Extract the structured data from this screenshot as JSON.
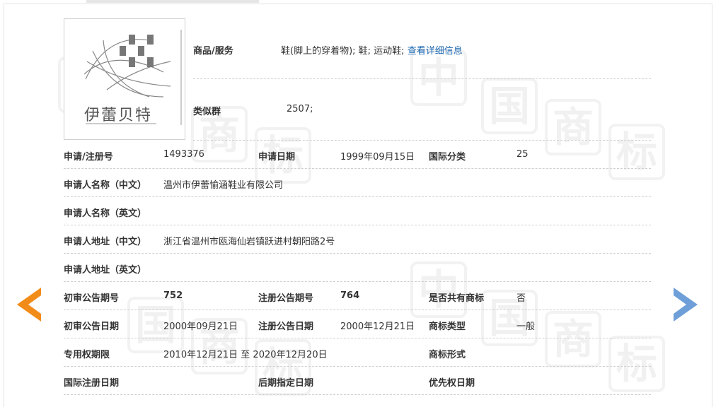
{
  "goods": {
    "label": "商品/服务",
    "value": "鞋(脚上的穿着物); 鞋; 运动鞋;",
    "link": "查看详细信息"
  },
  "similar": {
    "label": "类似群",
    "value": "2507;"
  },
  "logo": {
    "text": "伊蕾贝特"
  },
  "watermark": {
    "chars": [
      "中",
      "国",
      "商",
      "标"
    ]
  },
  "rows": {
    "reg_no": {
      "label": "申请/注册号",
      "value": "1493376"
    },
    "apply_date": {
      "label": "申请日期",
      "value": "1999年09月15日"
    },
    "intl_class": {
      "label": "国际分类",
      "value": "25"
    },
    "applicant_cn": {
      "label": "申请人名称（中文）",
      "value": "温州市伊蕾愉涵鞋业有限公司"
    },
    "applicant_en": {
      "label": "申请人名称（英文）",
      "value": ""
    },
    "address_cn": {
      "label": "申请人地址（中文）",
      "value": "浙江省温州市瓯海仙岩镇跃进村朝阳路2号"
    },
    "address_en": {
      "label": "申请人地址（英文）",
      "value": ""
    },
    "prelim_no": {
      "label": "初审公告期号",
      "value": "752"
    },
    "reg_notice_no": {
      "label": "注册公告期号",
      "value": "764"
    },
    "shared": {
      "label": "是否共有商标",
      "value": "否"
    },
    "prelim_date": {
      "label": "初审公告日期",
      "value": "2000年09月21日"
    },
    "reg_notice_date": {
      "label": "注册公告日期",
      "value": "2000年12月21日"
    },
    "mark_type": {
      "label": "商标类型",
      "value": "一般"
    },
    "term": {
      "label": "专用权期限",
      "value": "2010年12月21日 至 2020年12月20日"
    },
    "mark_form": {
      "label": "商标形式",
      "value": ""
    },
    "intl_reg_date": {
      "label": "国际注册日期",
      "value": ""
    },
    "later_date": {
      "label": "后期指定日期",
      "value": ""
    },
    "priority_date": {
      "label": "优先权日期",
      "value": ""
    }
  },
  "colors": {
    "link": "#1a67b2",
    "prev_arrow": "#f28c18",
    "next_arrow": "#6f9fd8"
  }
}
